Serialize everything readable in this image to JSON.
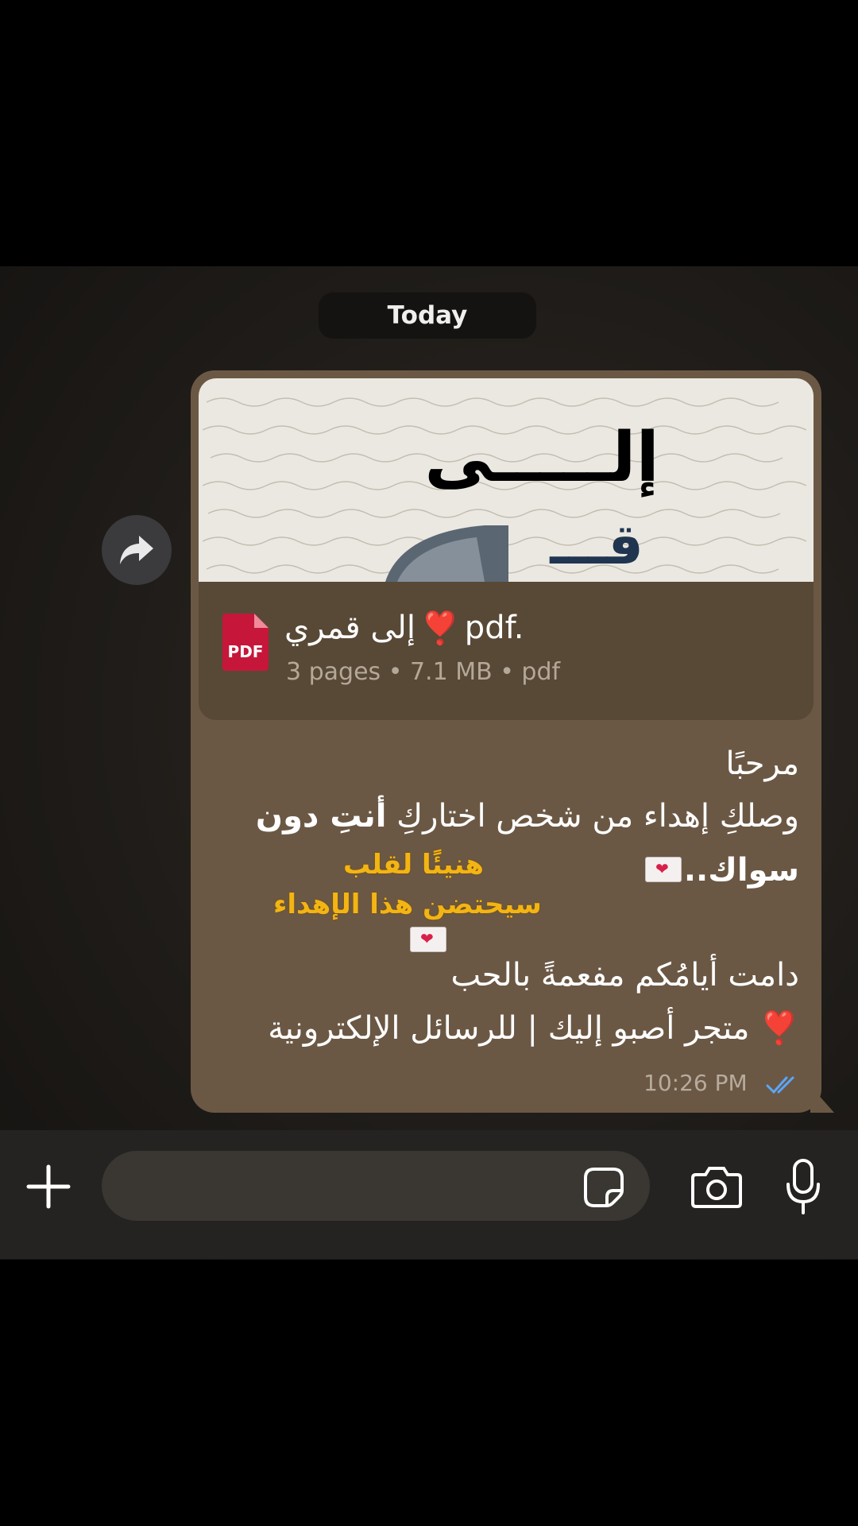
{
  "date_chip": "Today",
  "document": {
    "preview_heading": "إلـــــى",
    "preview_subheading": "قـــ",
    "file_name": "إلى قمري",
    "file_ext": "pdf.",
    "file_emoji": "❣️",
    "file_type_badge": "PDF",
    "meta": "3 pages • 7.1 MB • pdf"
  },
  "message": {
    "line1": "مرحبًا",
    "line2_prefix": "وصلكِ إهداء من شخص اختاركِ",
    "line2_bold": "أنتِ دون",
    "line3": "سواك..",
    "gold_line1": "هنيئًا لقلب",
    "gold_line2": "سيحتضن هذا الإهداء",
    "line4": "دامت أيامُكم مفعمةً بالحب",
    "line5": "متجر أصبو إليك | للرسائل الإلكترونية",
    "line5_emoji": "❣️"
  },
  "timestamp": "10:26 PM",
  "colors": {
    "bubble": "#6b5844",
    "doc_card": "#584836",
    "read_ticks": "#5aa6ff",
    "gold_text": "#f3b514",
    "pdf_red": "#c6173a"
  },
  "icons": [
    "forward-icon",
    "pdf-file-icon",
    "double-check-icon",
    "plus-icon",
    "sticker-icon",
    "camera-icon",
    "microphone-icon",
    "envelope-heart-icon"
  ]
}
